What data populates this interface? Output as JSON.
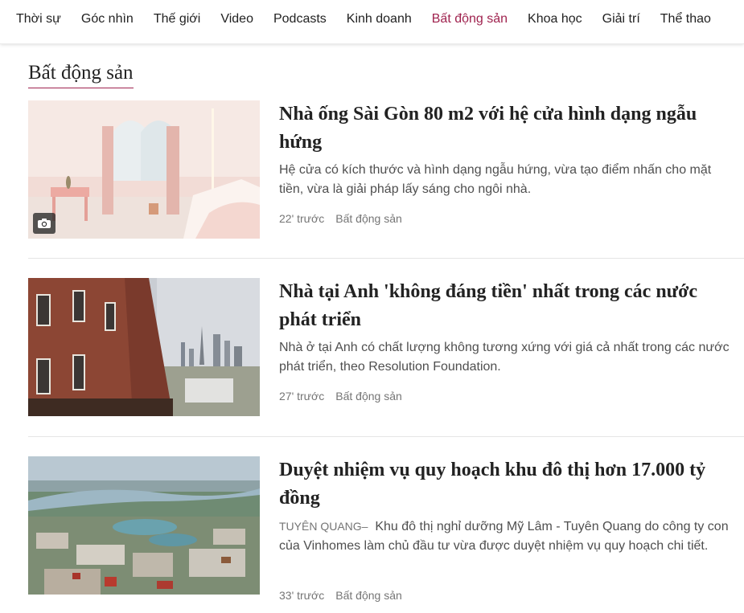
{
  "nav": {
    "items": [
      "Thời sự",
      "Góc nhìn",
      "Thế giới",
      "Video",
      "Podcasts",
      "Kinh doanh",
      "Bất động sản",
      "Khoa học",
      "Giải trí",
      "Thể thao"
    ],
    "active_index": 6,
    "accent_color": "#9f224e"
  },
  "section": {
    "title": "Bất động sản"
  },
  "articles": [
    {
      "title": "Nhà ống Sài Gòn 80 m2 với hệ cửa hình dạng ngẫu hứng",
      "location": "",
      "description": "Hệ cửa có kích thước và hình dạng ngẫu hứng, vừa tạo điểm nhấn cho mặt tiền, vừa là giải pháp lấy sáng cho ngôi nhà.",
      "time": "22' trước",
      "category": "Bất động sản",
      "thumb_icon": "camera-icon"
    },
    {
      "title": "Nhà tại Anh 'không đáng tiền' nhất trong các nước phát triển",
      "location": "",
      "description": "Nhà ở tại Anh có chất lượng không tương xứng với giá cả nhất trong các nước phát triển, theo Resolution Foundation.",
      "time": "27' trước",
      "category": "Bất động sản"
    },
    {
      "title": "Duyệt nhiệm vụ quy hoạch khu đô thị hơn 17.000 tỷ đồng",
      "location": "TUYÊN QUANG–",
      "description": "Khu đô thị nghỉ dưỡng Mỹ Lâm - Tuyên Quang do công ty con của Vinhomes làm chủ đầu tư vừa được duyệt nhiệm vụ quy hoạch chi tiết.",
      "time": "33' trước",
      "category": "Bất động sản"
    }
  ]
}
